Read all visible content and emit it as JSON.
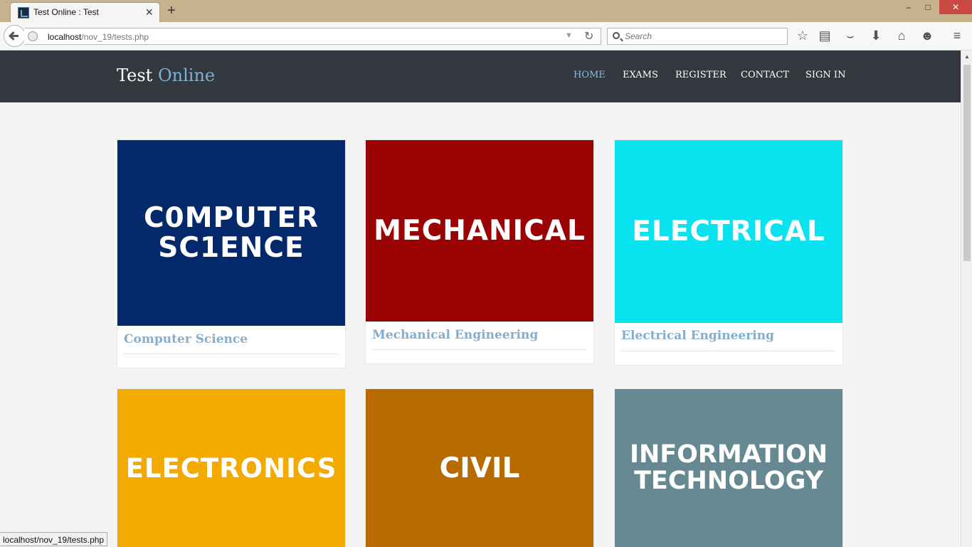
{
  "browser": {
    "tab_title": "Test Online : Test",
    "url_host": "localhost",
    "url_path": "/nov_19/tests.php",
    "search_placeholder": "Search",
    "status_url": "localhost/nov_19/tests.php",
    "window_controls": {
      "minimize": "–",
      "maximize": "□",
      "close": "✕"
    },
    "icons": [
      "back-icon",
      "globe-icon",
      "dropdown-icon",
      "reload-icon",
      "search-icon",
      "bookmark-star-icon",
      "reading-list-icon",
      "pocket-icon",
      "download-icon",
      "home-icon",
      "chat-icon",
      "menu-icon"
    ]
  },
  "site": {
    "logo_primary": "Test",
    "logo_accent": "Online",
    "nav": [
      "HOME",
      "EXAMS",
      "REGISTER",
      "CONTACT",
      "SIGN IN"
    ],
    "active_nav": "HOME"
  },
  "courses": [
    {
      "title": "Computer Science",
      "image_text_line_1": "C0MPUTER",
      "image_text_line_2": "SC1ENCE",
      "color": "#03296b"
    },
    {
      "title": "Mechanical Engineering",
      "image_text_line_1": "MECHANICAL",
      "color": "#9b0203"
    },
    {
      "title": "Electrical Engineering",
      "image_text_line_1": "ELECTRICAL",
      "color": "#08e3ef"
    },
    {
      "title": "",
      "image_text_line_1": "ELECTRONICS",
      "color": "#f2aa00"
    },
    {
      "title": "",
      "image_text_line_1": "CIVIL",
      "color": "#b66a00"
    },
    {
      "title": "",
      "image_text_line_1": "INFORMATION",
      "image_text_line_2": "TECHNOLOGY",
      "color": "#668891"
    }
  ]
}
